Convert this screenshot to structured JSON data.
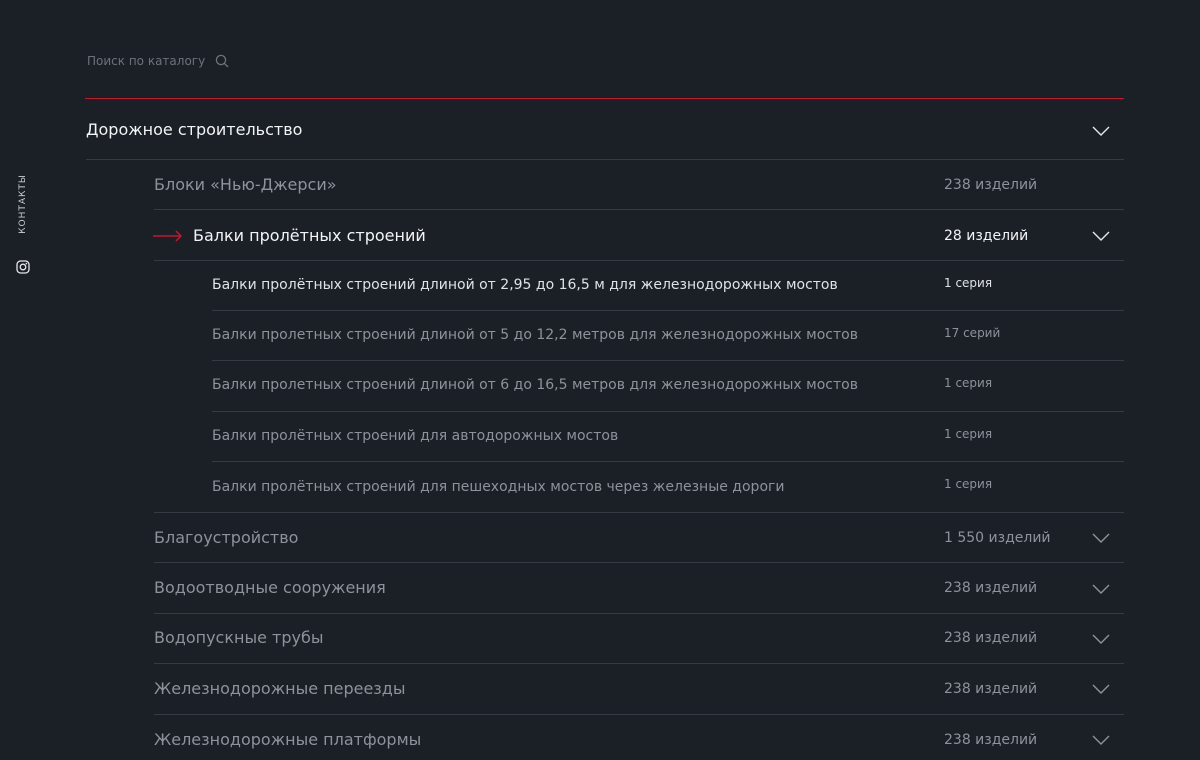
{
  "sidebar": {
    "contacts_label": "КОНТАКТЫ",
    "social_icon": "instagram-icon"
  },
  "search": {
    "placeholder": "Поиск по каталогу",
    "icon": "search-icon"
  },
  "colors": {
    "accent": "#c3172b",
    "background": "#1b1f26"
  },
  "category": {
    "title": "Дорожное строительство",
    "expanded": true
  },
  "subcategories": [
    {
      "label": "Блоки «Нью-Джерси»",
      "count": "238 изделий"
    },
    {
      "label": "Балки пролётных строений",
      "count": "28 изделий",
      "active": true,
      "expanded": true
    },
    {
      "label": "Благоустройство",
      "count": "1 550 изделий"
    },
    {
      "label": "Водоотводные сооружения",
      "count": "238 изделий"
    },
    {
      "label": "Водопускные трубы",
      "count": "238 изделий"
    },
    {
      "label": "Железнодорожные переезды",
      "count": "238 изделий"
    },
    {
      "label": "Железнодорожные платформы",
      "count": "238 изделий"
    }
  ],
  "leaf_items": [
    {
      "label": "Балки пролётных строений длиной от 2,95 до 16,5 м для железнодорожных мостов",
      "count": "1 серия",
      "active": true
    },
    {
      "label": "Балки пролетных строений длиной от 5 до 12,2 метров для железнодорожных мостов",
      "count": "17 серий"
    },
    {
      "label": "Балки пролетных строений длиной от 6 до 16,5 метров для железнодорожных мостов",
      "count": "1 серия"
    },
    {
      "label": "Балки пролётных строений для автодорожных мостов",
      "count": "1 серия"
    },
    {
      "label": "Балки пролётных строений для пешеходных мостов через железные дороги",
      "count": "1 серия"
    }
  ]
}
